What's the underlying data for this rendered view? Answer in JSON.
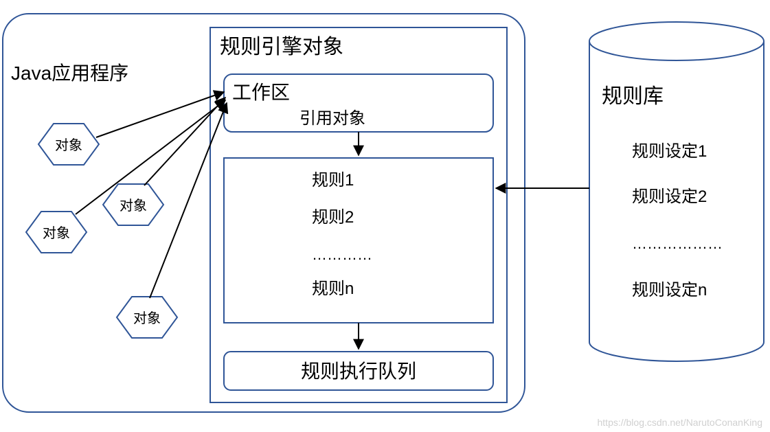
{
  "java_app_label": "Java应用程序",
  "hexagons": [
    "对象",
    "对象",
    "对象",
    "对象"
  ],
  "engine": {
    "title": "规则引擎对象",
    "work_area_title": "工作区",
    "work_area_sub": "引用对象",
    "rules": [
      "规则1",
      "规则2",
      "…………",
      "规则n"
    ],
    "queue_label": "规则执行队列"
  },
  "rulebase": {
    "title": "规则库",
    "items": [
      "规则设定1",
      "规则设定2",
      "………………",
      "规则设定n"
    ]
  },
  "watermark": "https://blog.csdn.net/NarutoConanKing"
}
